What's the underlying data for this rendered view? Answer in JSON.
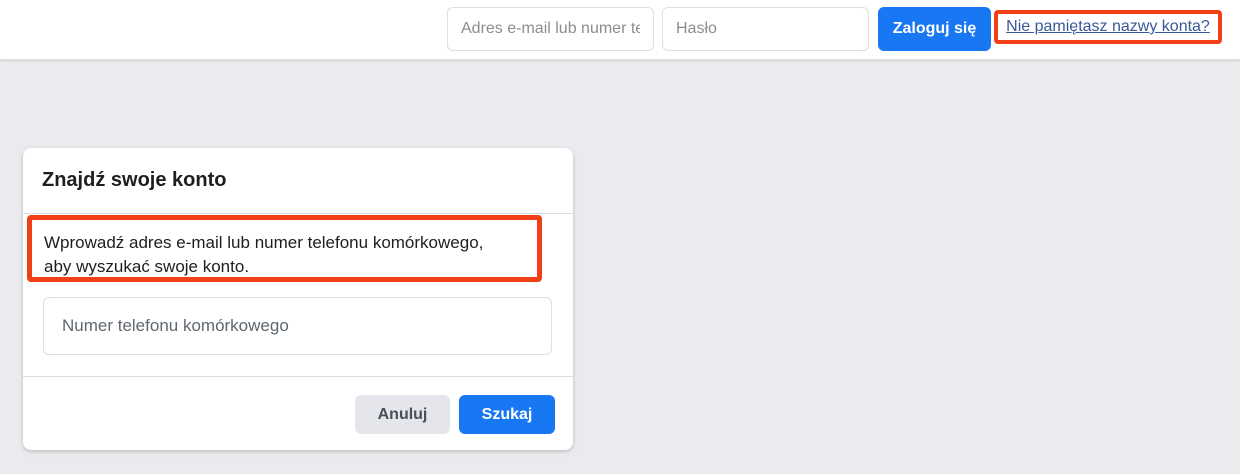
{
  "header": {
    "email_placeholder": "Adres e-mail lub numer telefonu",
    "password_placeholder": "Hasło",
    "login_label": "Zaloguj się",
    "forgot_label": "Nie pamiętasz nazwy konta?"
  },
  "dialog": {
    "title": "Znajdź swoje konto",
    "instructions_line1": "Wprowadź adres e-mail lub numer telefonu komórkowego,",
    "instructions_line2": "aby wyszukać swoje konto.",
    "phone_placeholder": "Numer telefonu komórkowego",
    "cancel_label": "Anuluj",
    "search_label": "Szukaj"
  },
  "colors": {
    "accent": "#1877f2",
    "highlight": "#f03e17",
    "link": "#385898",
    "background": "#e9ebee"
  }
}
